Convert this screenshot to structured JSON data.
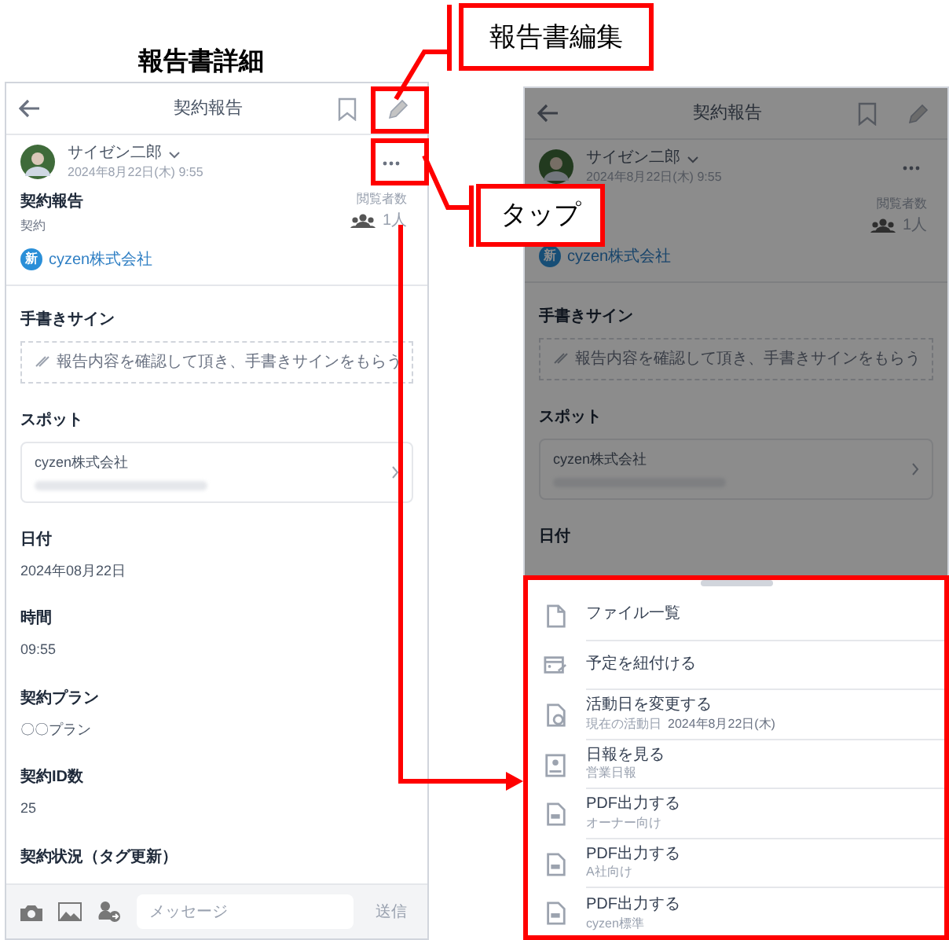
{
  "title": "報告書詳細",
  "callouts": [
    {
      "text": "報告書編集"
    },
    {
      "text": "タップ"
    }
  ],
  "screens": [
    {
      "dimmed": false,
      "header": {
        "title": "契約報告"
      },
      "author": {
        "name": "サイゼン二郎",
        "datetime": "2024年8月22日(木) 9:55"
      },
      "report": {
        "title": "契約報告",
        "subtitle": "契約"
      },
      "viewers": {
        "label": "閲覧者数",
        "count": "1人"
      },
      "customer": {
        "badge": "新",
        "name": "cyzen株式会社"
      },
      "fields": [
        {
          "kind": "signature",
          "label": "手書きサイン",
          "placeholder": "報告内容を確認して頂き、手書きサインをもらう"
        },
        {
          "kind": "spot",
          "label": "スポット",
          "value": "cyzen株式会社"
        },
        {
          "kind": "text",
          "label": "日付",
          "value": "2024年08月22日"
        },
        {
          "kind": "text",
          "label": "時間",
          "value": "09:55"
        },
        {
          "kind": "text",
          "label": "契約プラン",
          "value": "〇〇プラン"
        },
        {
          "kind": "text",
          "label": "契約ID数",
          "value": "25"
        },
        {
          "kind": "text",
          "label": "契約状況（タグ更新）"
        }
      ],
      "composer": {
        "placeholder": "メッセージ",
        "send": "送信"
      }
    },
    {
      "dimmed": true,
      "header": {
        "title": "契約報告"
      },
      "author": {
        "name": "サイゼン二郎",
        "datetime": "2024年8月22日(木) 9:55"
      },
      "viewers": {
        "label": "閲覧者数",
        "count": "1人"
      },
      "customer": {
        "badge": "新",
        "name": "cyzen株式会社"
      },
      "fields": [
        {
          "kind": "signature",
          "label": "手書きサイン",
          "placeholder": "報告内容を確認して頂き、手書きサインをもらう"
        },
        {
          "kind": "spot",
          "label": "スポット",
          "value": "cyzen株式会社"
        },
        {
          "kind": "text",
          "label": "日付"
        }
      ],
      "sheet": {
        "items": [
          {
            "kind": "file",
            "label": "ファイル一覧"
          },
          {
            "kind": "link",
            "label": "予定を紐付ける"
          },
          {
            "kind": "calendar",
            "label": "活動日を変更する",
            "note": "現在の活動日",
            "detail": "2024年8月22日(木)"
          },
          {
            "kind": "report",
            "label": "日報を見る",
            "note": "営業日報"
          },
          {
            "kind": "pdf",
            "label": "PDF出力する",
            "note": "オーナー向け"
          },
          {
            "kind": "pdf",
            "label": "PDF出力する",
            "note": "A社向け"
          },
          {
            "kind": "pdf",
            "label": "PDF出力する",
            "note": "cyzen標準"
          }
        ]
      }
    }
  ]
}
